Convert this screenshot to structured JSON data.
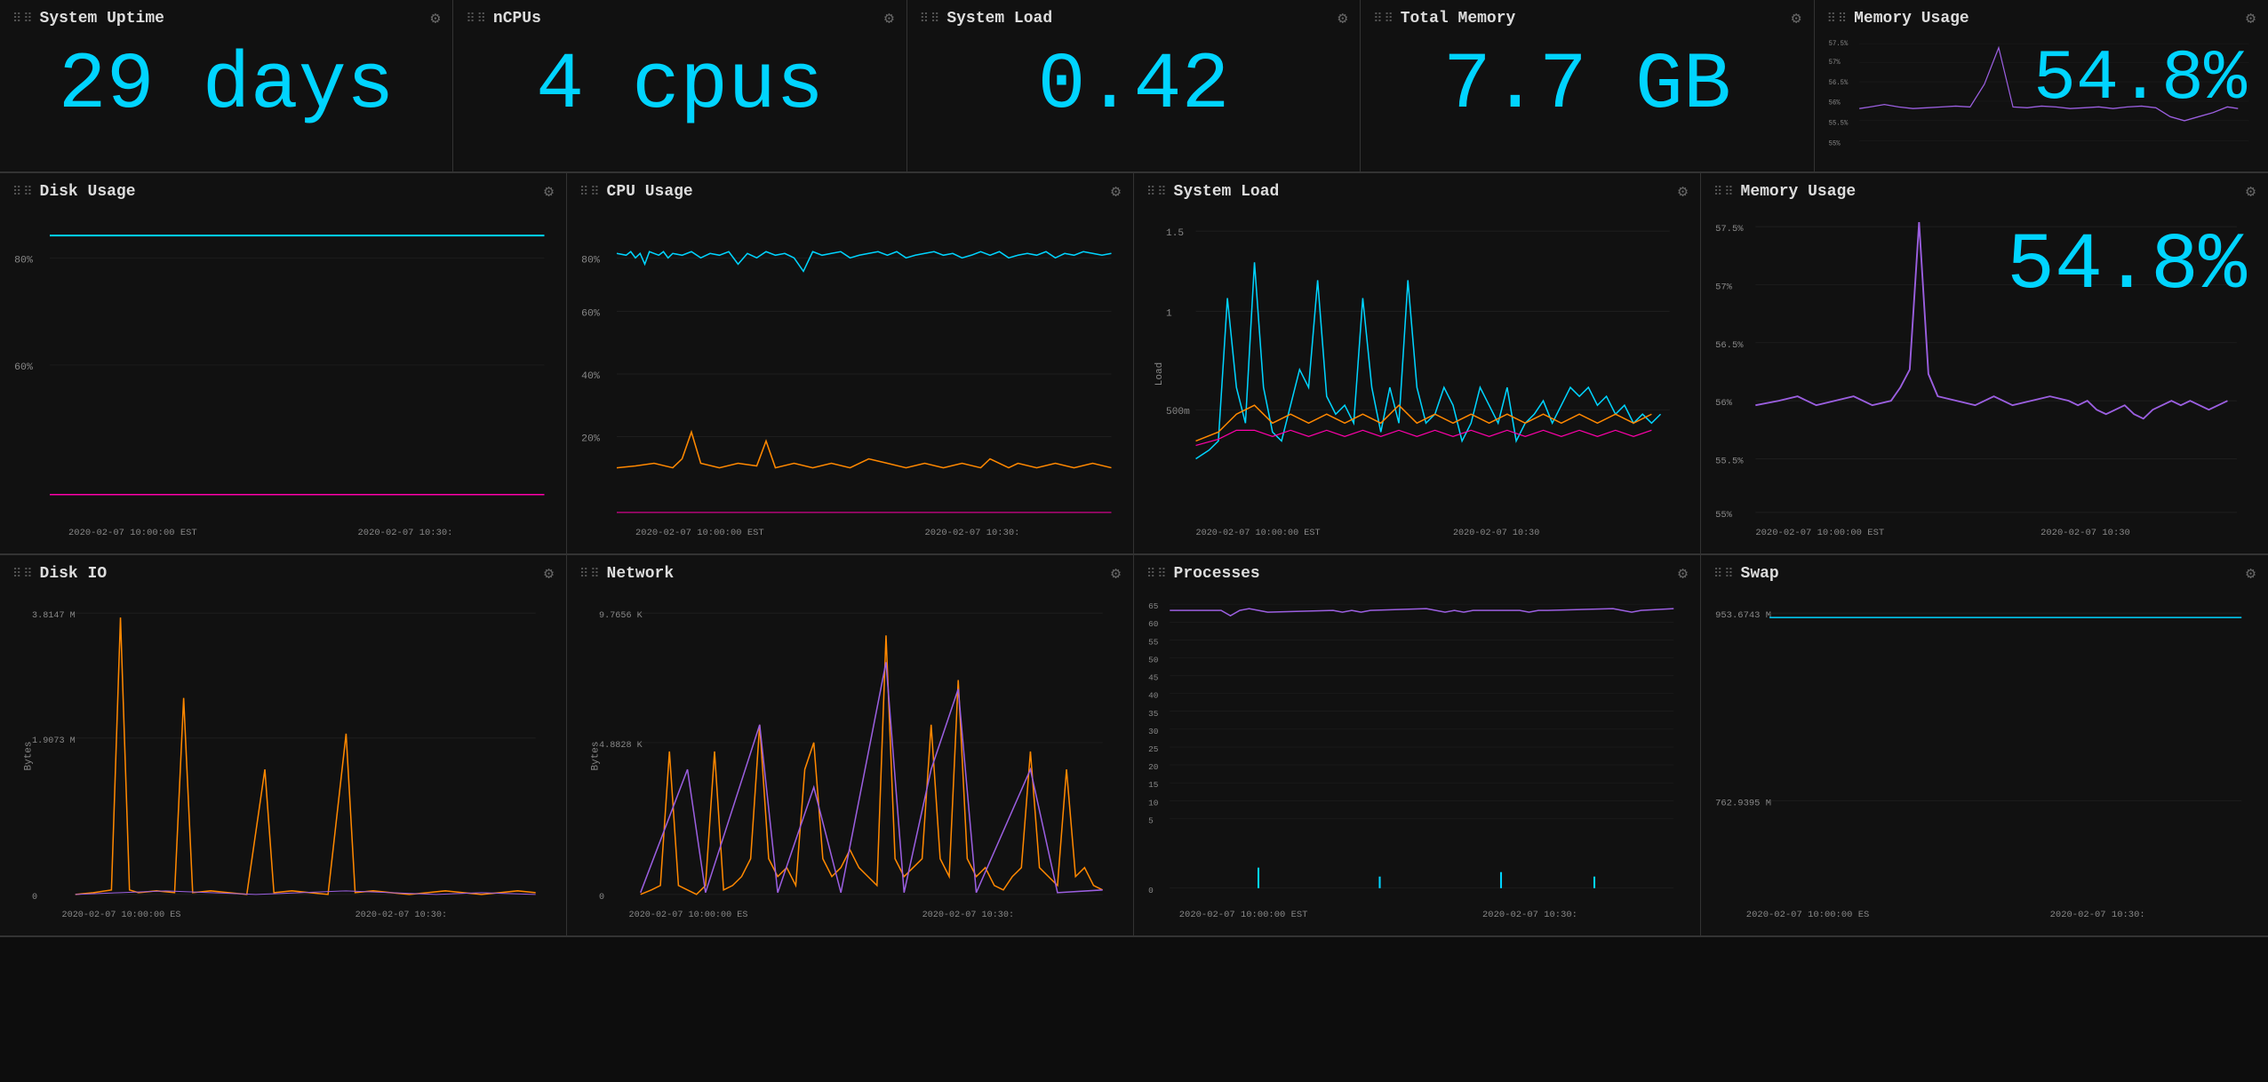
{
  "top": {
    "uptime": {
      "title": "System Uptime",
      "value": "29 days"
    },
    "ncpus": {
      "title": "nCPUs",
      "value": "4 cpus"
    },
    "sysload": {
      "title": "System Load",
      "value": "0.42"
    },
    "totalmem": {
      "title": "Total Memory",
      "value": "7.7 GB"
    },
    "memusage": {
      "title": "Memory Usage",
      "value": "54.8%"
    }
  },
  "mid": {
    "disk": {
      "title": "Disk Usage",
      "yLabels": [
        "80%",
        "60%"
      ],
      "xLabels": [
        "2020-02-07 10:00:00 EST",
        "2020-02-07 10:30:"
      ]
    },
    "cpu": {
      "title": "CPU Usage",
      "yLabels": [
        "80%",
        "60%",
        "40%",
        "20%"
      ],
      "xLabels": [
        "2020-02-07 10:00:00 EST",
        "2020-02-07 10:30:"
      ]
    },
    "sysload2": {
      "title": "System Load",
      "yLabels": [
        "1.5",
        "1",
        "500m"
      ],
      "xLabels": [
        "2020-02-07 10:00:00 EST",
        "2020-02-07 10:30"
      ]
    },
    "memusage2": {
      "title": "Memory Usage",
      "bigValue": "54.8%",
      "yLabels": [
        "57.5%",
        "57%",
        "56.5%",
        "56%",
        "55.5%",
        "55%"
      ],
      "xLabels": [
        "2020-02-07 10:00:00 EST",
        "2020-02-07 10:30"
      ]
    }
  },
  "bot": {
    "diskio": {
      "title": "Disk IO",
      "yLabels": [
        "3.8147 M",
        "1.9073 M",
        "0"
      ],
      "axisLabel": "Bytes",
      "xLabels": [
        "2020-02-07 10:00:00 ES",
        "2020-02-07 10:30:"
      ]
    },
    "network": {
      "title": "Network",
      "yLabels": [
        "9.7656 K",
        "4.8828 K",
        "0"
      ],
      "axisLabel": "Bytes",
      "xLabels": [
        "2020-02-07 10:00:00 ES",
        "2020-02-07 10:30:"
      ]
    },
    "processes": {
      "title": "Processes",
      "yLabels": [
        "65",
        "60",
        "55",
        "50",
        "45",
        "40",
        "35",
        "30",
        "25",
        "20",
        "15",
        "10",
        "5",
        "0"
      ],
      "xLabels": [
        "2020-02-07 10:00:00 EST",
        "2020-02-07 10:30:"
      ]
    },
    "swap": {
      "title": "Swap",
      "yLabels": [
        "953.6743 M",
        "762.9395 M"
      ],
      "xLabels": [
        "2020-02-07 10:00:00 ES",
        "2020-02-07 10:30:"
      ]
    }
  },
  "icons": {
    "gear": "⚙",
    "dots": "⋮⋮"
  }
}
